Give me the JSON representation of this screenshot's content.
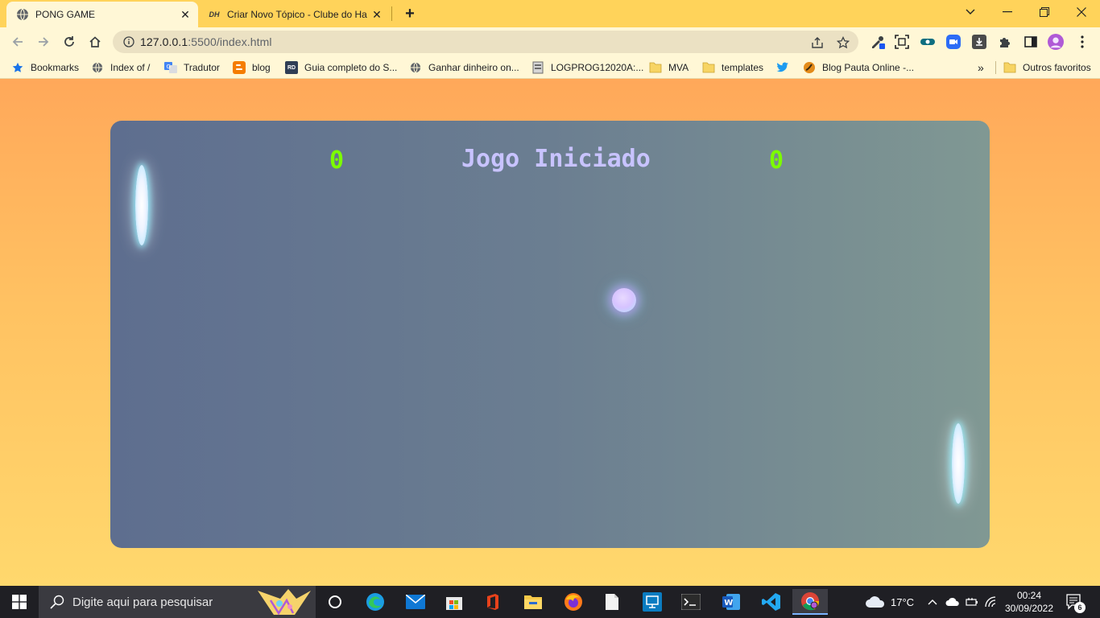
{
  "browser": {
    "tabs": [
      {
        "title": "PONG GAME",
        "active": true,
        "favicon": "globe-icon"
      },
      {
        "title": "Criar Novo Tópico - Clube do Ha",
        "active": false,
        "favicon": "dh-logo-icon"
      }
    ],
    "favicon_dh_text": "DH",
    "url_main": "127.0.0.1",
    "url_rest": ":5500/index.html",
    "bookmarks": [
      {
        "label": "Bookmarks",
        "icon": "star-icon"
      },
      {
        "label": "Index of /",
        "icon": "globe-icon"
      },
      {
        "label": "Tradutor",
        "icon": "translate-icon"
      },
      {
        "label": "blog",
        "icon": "blogger-icon"
      },
      {
        "label": "Guia completo do S...",
        "icon": "rd-icon"
      },
      {
        "label": "Ganhar dinheiro on...",
        "icon": "globe-icon"
      },
      {
        "label": "LOGPROG12020A:...",
        "icon": "page-icon"
      },
      {
        "label": "MVA",
        "icon": "folder-icon"
      },
      {
        "label": "templates",
        "icon": "folder-icon"
      },
      {
        "label": "",
        "icon": "twitter-icon"
      },
      {
        "label": "Blog Pauta Online -...",
        "icon": "blog-icon"
      }
    ],
    "bookmarks_rd_text": "RD",
    "bookmarks_overflow": "»",
    "other_bookmarks": "Outros favoritos"
  },
  "game": {
    "score_left": "0",
    "score_right": "0",
    "status": "Jogo Iniciado"
  },
  "taskbar": {
    "search_placeholder": "Digite aqui para pesquisar",
    "weather": "17°C",
    "time": "00:24",
    "date": "30/09/2022",
    "notifications": "6"
  },
  "colors": {
    "score": "#7cfc00",
    "status": "#c8c3ff",
    "court_left": "#5e6e8f",
    "court_right": "#809893",
    "page_top": "#ffa85a",
    "page_bottom": "#ffd86d",
    "chrome_frame": "#ffd35a",
    "chrome_toolbar": "#fff7d6"
  }
}
